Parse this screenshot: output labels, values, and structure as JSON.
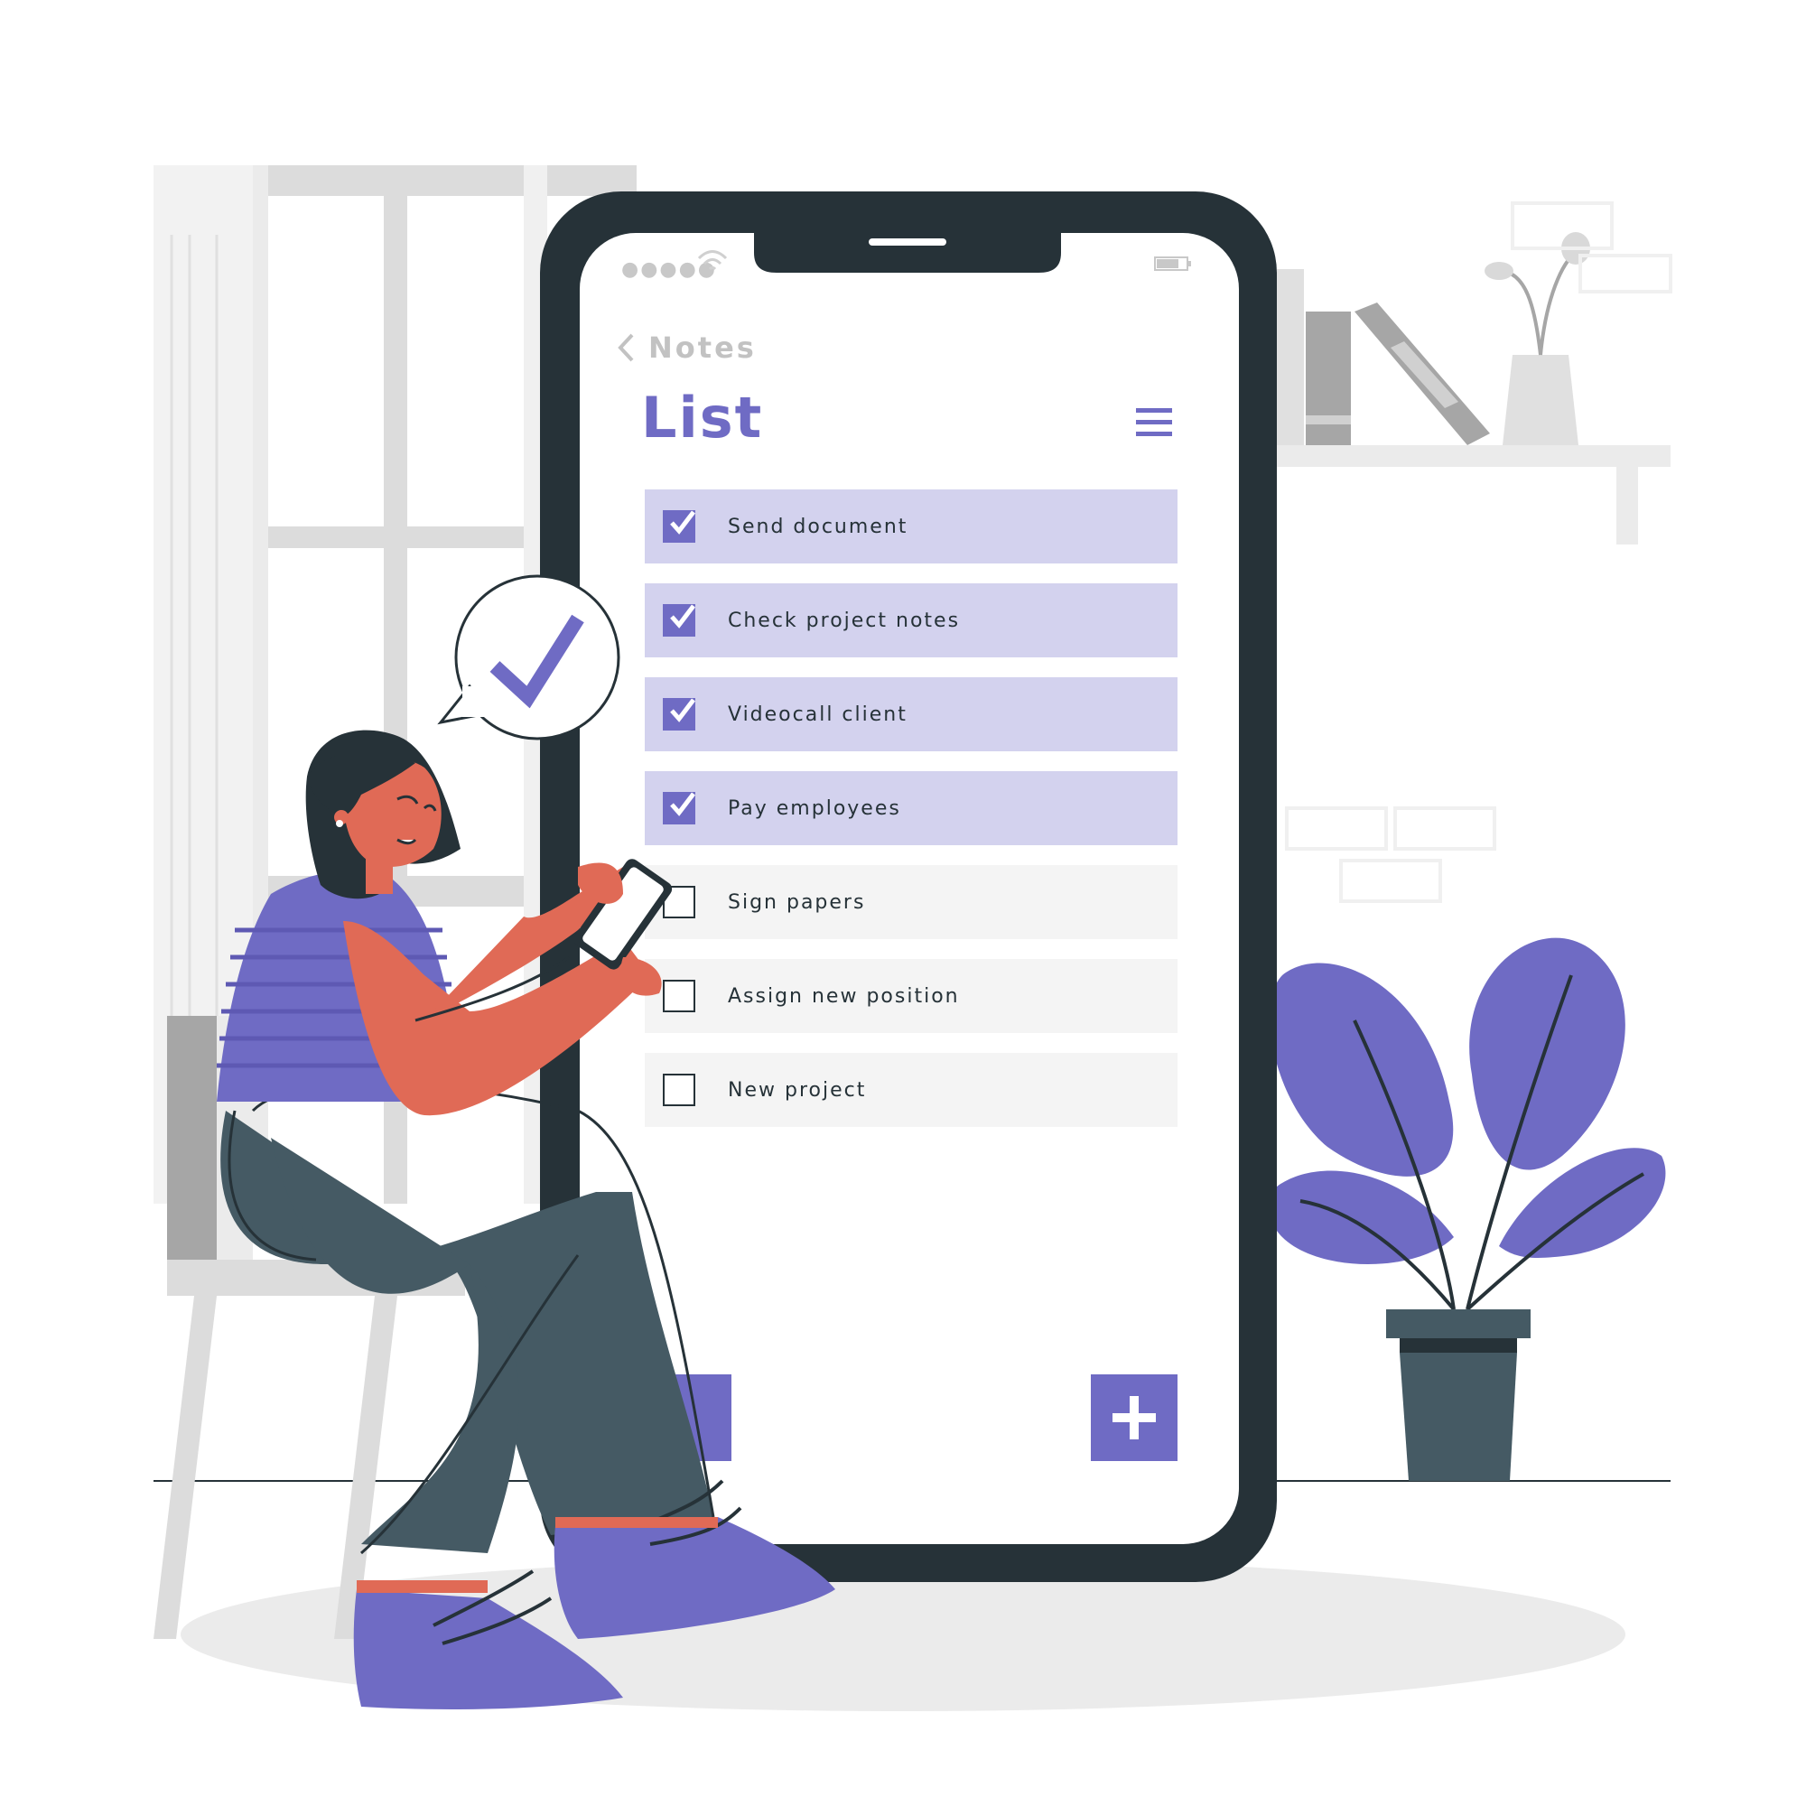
{
  "app": {
    "back_label": "Notes",
    "title": "List"
  },
  "tasks": [
    {
      "label": "Send document",
      "checked": true
    },
    {
      "label": "Check project notes",
      "checked": true
    },
    {
      "label": "Videocall client",
      "checked": true
    },
    {
      "label": "Pay employees",
      "checked": true
    },
    {
      "label": "Sign papers",
      "checked": false
    },
    {
      "label": "Assign new position",
      "checked": false
    },
    {
      "label": "New project",
      "checked": false
    }
  ],
  "icons": {
    "back": "chevron-left-icon",
    "menu": "hamburger-menu-icon",
    "add": "plus-icon",
    "check": "checkmark-icon"
  },
  "colors": {
    "accent": "#6f6bc4",
    "accent_light": "#d3d2ee",
    "dark": "#263238",
    "skin": "#e06a56",
    "pants": "#455a64"
  }
}
